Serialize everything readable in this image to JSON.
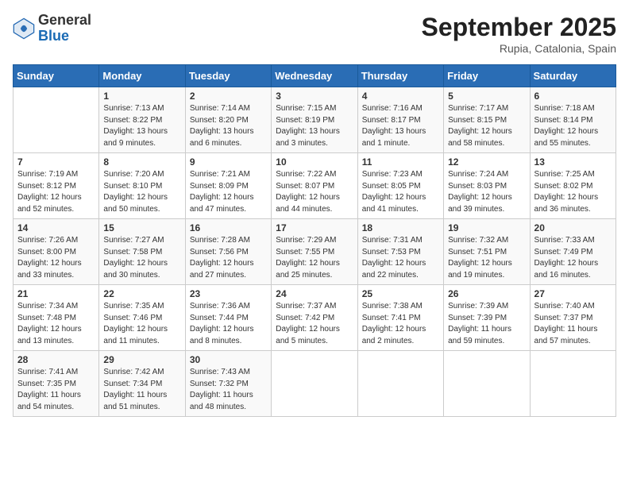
{
  "header": {
    "logo_general": "General",
    "logo_blue": "Blue",
    "month_title": "September 2025",
    "location": "Rupia, Catalonia, Spain"
  },
  "days_of_week": [
    "Sunday",
    "Monday",
    "Tuesday",
    "Wednesday",
    "Thursday",
    "Friday",
    "Saturday"
  ],
  "weeks": [
    [
      {
        "day": "",
        "info": ""
      },
      {
        "day": "1",
        "info": "Sunrise: 7:13 AM\nSunset: 8:22 PM\nDaylight: 13 hours\nand 9 minutes."
      },
      {
        "day": "2",
        "info": "Sunrise: 7:14 AM\nSunset: 8:20 PM\nDaylight: 13 hours\nand 6 minutes."
      },
      {
        "day": "3",
        "info": "Sunrise: 7:15 AM\nSunset: 8:19 PM\nDaylight: 13 hours\nand 3 minutes."
      },
      {
        "day": "4",
        "info": "Sunrise: 7:16 AM\nSunset: 8:17 PM\nDaylight: 13 hours\nand 1 minute."
      },
      {
        "day": "5",
        "info": "Sunrise: 7:17 AM\nSunset: 8:15 PM\nDaylight: 12 hours\nand 58 minutes."
      },
      {
        "day": "6",
        "info": "Sunrise: 7:18 AM\nSunset: 8:14 PM\nDaylight: 12 hours\nand 55 minutes."
      }
    ],
    [
      {
        "day": "7",
        "info": "Sunrise: 7:19 AM\nSunset: 8:12 PM\nDaylight: 12 hours\nand 52 minutes."
      },
      {
        "day": "8",
        "info": "Sunrise: 7:20 AM\nSunset: 8:10 PM\nDaylight: 12 hours\nand 50 minutes."
      },
      {
        "day": "9",
        "info": "Sunrise: 7:21 AM\nSunset: 8:09 PM\nDaylight: 12 hours\nand 47 minutes."
      },
      {
        "day": "10",
        "info": "Sunrise: 7:22 AM\nSunset: 8:07 PM\nDaylight: 12 hours\nand 44 minutes."
      },
      {
        "day": "11",
        "info": "Sunrise: 7:23 AM\nSunset: 8:05 PM\nDaylight: 12 hours\nand 41 minutes."
      },
      {
        "day": "12",
        "info": "Sunrise: 7:24 AM\nSunset: 8:03 PM\nDaylight: 12 hours\nand 39 minutes."
      },
      {
        "day": "13",
        "info": "Sunrise: 7:25 AM\nSunset: 8:02 PM\nDaylight: 12 hours\nand 36 minutes."
      }
    ],
    [
      {
        "day": "14",
        "info": "Sunrise: 7:26 AM\nSunset: 8:00 PM\nDaylight: 12 hours\nand 33 minutes."
      },
      {
        "day": "15",
        "info": "Sunrise: 7:27 AM\nSunset: 7:58 PM\nDaylight: 12 hours\nand 30 minutes."
      },
      {
        "day": "16",
        "info": "Sunrise: 7:28 AM\nSunset: 7:56 PM\nDaylight: 12 hours\nand 27 minutes."
      },
      {
        "day": "17",
        "info": "Sunrise: 7:29 AM\nSunset: 7:55 PM\nDaylight: 12 hours\nand 25 minutes."
      },
      {
        "day": "18",
        "info": "Sunrise: 7:31 AM\nSunset: 7:53 PM\nDaylight: 12 hours\nand 22 minutes."
      },
      {
        "day": "19",
        "info": "Sunrise: 7:32 AM\nSunset: 7:51 PM\nDaylight: 12 hours\nand 19 minutes."
      },
      {
        "day": "20",
        "info": "Sunrise: 7:33 AM\nSunset: 7:49 PM\nDaylight: 12 hours\nand 16 minutes."
      }
    ],
    [
      {
        "day": "21",
        "info": "Sunrise: 7:34 AM\nSunset: 7:48 PM\nDaylight: 12 hours\nand 13 minutes."
      },
      {
        "day": "22",
        "info": "Sunrise: 7:35 AM\nSunset: 7:46 PM\nDaylight: 12 hours\nand 11 minutes."
      },
      {
        "day": "23",
        "info": "Sunrise: 7:36 AM\nSunset: 7:44 PM\nDaylight: 12 hours\nand 8 minutes."
      },
      {
        "day": "24",
        "info": "Sunrise: 7:37 AM\nSunset: 7:42 PM\nDaylight: 12 hours\nand 5 minutes."
      },
      {
        "day": "25",
        "info": "Sunrise: 7:38 AM\nSunset: 7:41 PM\nDaylight: 12 hours\nand 2 minutes."
      },
      {
        "day": "26",
        "info": "Sunrise: 7:39 AM\nSunset: 7:39 PM\nDaylight: 11 hours\nand 59 minutes."
      },
      {
        "day": "27",
        "info": "Sunrise: 7:40 AM\nSunset: 7:37 PM\nDaylight: 11 hours\nand 57 minutes."
      }
    ],
    [
      {
        "day": "28",
        "info": "Sunrise: 7:41 AM\nSunset: 7:35 PM\nDaylight: 11 hours\nand 54 minutes."
      },
      {
        "day": "29",
        "info": "Sunrise: 7:42 AM\nSunset: 7:34 PM\nDaylight: 11 hours\nand 51 minutes."
      },
      {
        "day": "30",
        "info": "Sunrise: 7:43 AM\nSunset: 7:32 PM\nDaylight: 11 hours\nand 48 minutes."
      },
      {
        "day": "",
        "info": ""
      },
      {
        "day": "",
        "info": ""
      },
      {
        "day": "",
        "info": ""
      },
      {
        "day": "",
        "info": ""
      }
    ]
  ]
}
